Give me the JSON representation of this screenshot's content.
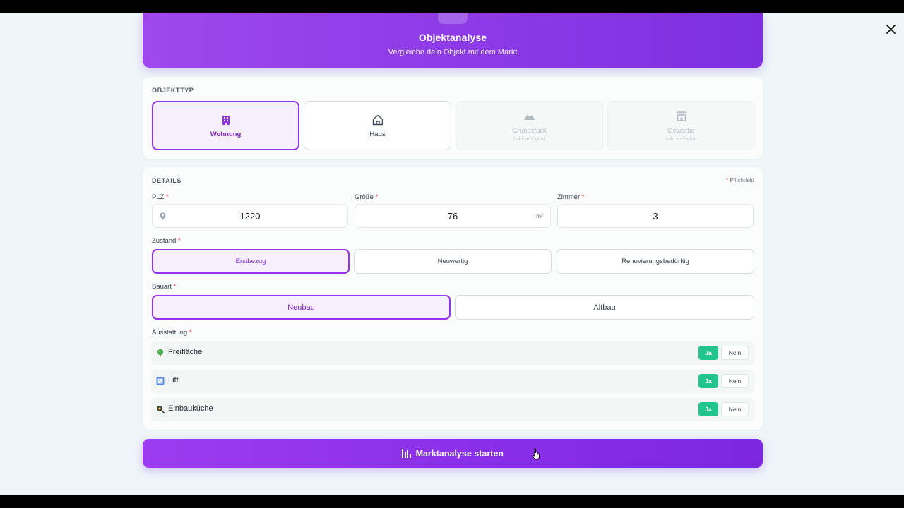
{
  "header": {
    "title": "Objektanalyse",
    "subtitle": "Vergleiche dein Objekt mit dem Markt"
  },
  "object_type": {
    "section_label": "OBJEKTTYP",
    "tiles": [
      {
        "label": "Wohnung",
        "sub": "",
        "state": "selected",
        "icon": "building-icon"
      },
      {
        "label": "Haus",
        "sub": "",
        "state": "default",
        "icon": "house-icon"
      },
      {
        "label": "Grundstück",
        "sub": "bald verfügbar",
        "state": "disabled",
        "icon": "mountain-icon"
      },
      {
        "label": "Gewerbe",
        "sub": "bald verfügbar",
        "state": "disabled",
        "icon": "store-icon"
      }
    ]
  },
  "details": {
    "section_label": "DETAILS",
    "required_note": "Pflichtfeld",
    "plz": {
      "label": "PLZ",
      "value": "1220"
    },
    "size": {
      "label": "Größe",
      "value": "76",
      "unit": "m²"
    },
    "rooms": {
      "label": "Zimmer",
      "value": "3"
    },
    "condition": {
      "label": "Zustand",
      "options": [
        "Erstbezug",
        "Neuwertig",
        "Renovierungsbedürftig"
      ],
      "selected": "Erstbezug"
    },
    "construction": {
      "label": "Bauart",
      "options": [
        "Neubau",
        "Altbau"
      ],
      "selected": "Neubau"
    },
    "amenities": {
      "label": "Ausstattung",
      "yes_label": "Ja",
      "no_label": "Nein",
      "items": [
        {
          "label": "Freifläche",
          "icon": "tree-icon",
          "value": "Ja"
        },
        {
          "label": "Lift",
          "icon": "elevator-icon",
          "value": "Ja"
        },
        {
          "label": "Einbauküche",
          "icon": "frying-pan-icon",
          "value": "Ja"
        }
      ]
    }
  },
  "cta": {
    "label": "Marktanalyse starten",
    "icon": "bar-chart-icon"
  },
  "colors": {
    "accent": "#9333ea",
    "accent_bg": "#f8effd",
    "yes_green": "#22c58e",
    "required_star": "#ef4444"
  }
}
